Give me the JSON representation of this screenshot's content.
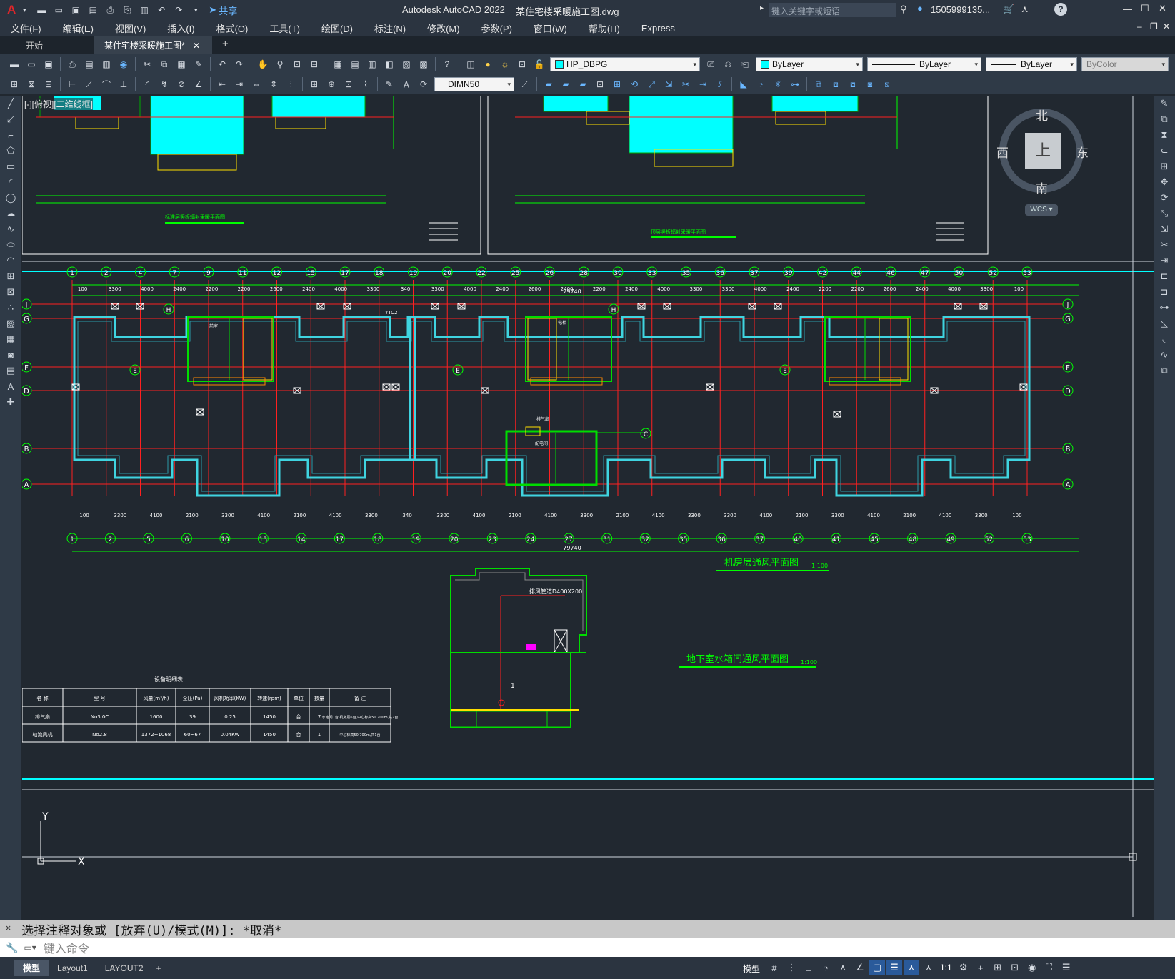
{
  "titlebar": {
    "app_title": "Autodesk AutoCAD 2022",
    "file_title": "某住宅楼采暖施工图.dwg",
    "share_label": "共享",
    "search_placeholder": "键入关键字或短语",
    "user_name": "1505999135..."
  },
  "menu": [
    "文件(F)",
    "编辑(E)",
    "视图(V)",
    "插入(I)",
    "格式(O)",
    "工具(T)",
    "绘图(D)",
    "标注(N)",
    "修改(M)",
    "参数(P)",
    "窗口(W)",
    "帮助(H)",
    "Express"
  ],
  "tabs": {
    "start": "开始",
    "doc": "某住宅楼采暖施工图*"
  },
  "toolbar": {
    "layer_name": "HP_DBPG",
    "color": "ByLayer",
    "linetype": "ByLayer",
    "lineweight": "ByLayer",
    "plotstyle": "ByColor",
    "dimstyle": "DIMN50"
  },
  "viewport": {
    "label": "[-][俯视][二维线框]"
  },
  "viewcube": {
    "north": "北",
    "south": "南",
    "east": "东",
    "west": "西",
    "top": "上",
    "wcs": "WCS"
  },
  "drawing": {
    "cols_top": [
      "1",
      "2",
      "4",
      "7",
      "9",
      "11",
      "12",
      "15",
      "17",
      "18",
      "19",
      "20",
      "22",
      "25",
      "26",
      "28",
      "30",
      "33",
      "35",
      "36",
      "37",
      "39",
      "42",
      "44",
      "46",
      "47",
      "50",
      "52",
      "53"
    ],
    "cols_bottom": [
      "1",
      "2",
      "5",
      "6",
      "10",
      "13",
      "14",
      "17",
      "18",
      "19",
      "20",
      "23",
      "24",
      "27",
      "31",
      "32",
      "35",
      "36",
      "37",
      "40",
      "41",
      "45",
      "48",
      "49",
      "52",
      "53"
    ],
    "rows": [
      "J",
      "G",
      "F",
      "D",
      "B",
      "A"
    ],
    "dims_top": [
      "100",
      "3300",
      "4000",
      "2400",
      "2200",
      "2200",
      "2600",
      "2400",
      "4000",
      "3300",
      "340",
      "3300",
      "4000",
      "2400",
      "2600",
      "2400",
      "2200",
      "2400",
      "4000",
      "3300",
      "3300",
      "4000",
      "2400",
      "2200",
      "2200",
      "2600",
      "2400",
      "4000",
      "3300",
      "100"
    ],
    "dims_bottom": [
      "100",
      "3300",
      "4100",
      "2100",
      "3300",
      "4100",
      "2100",
      "4100",
      "3300",
      "340",
      "3300",
      "4100",
      "2100",
      "4100",
      "3300",
      "2100",
      "4100",
      "3300",
      "3300",
      "4100",
      "2100",
      "3300",
      "4100",
      "2100",
      "4100",
      "3300",
      "100"
    ],
    "total": "79740",
    "ytc": "YTC2",
    "title_main": "机房层通风平面图",
    "scale_main": "1:100",
    "title_basement": "地下室水箱间通风平面图",
    "scale_basement": "1:100",
    "duct_label": "排风管道D400X200",
    "mini_title1": "标准层竖板辐射采暖平面图",
    "mini_title2": "顶层竖板辐射采暖平面图",
    "room_labels": [
      "前室",
      "电梯",
      "排气扇",
      "配电间"
    ],
    "tag_E": "E",
    "tag_H": "H",
    "tag_C": "C",
    "tag_2": "2",
    "tag_1": "1"
  },
  "table": {
    "title": "设备明细表",
    "headers": [
      "名 称",
      "型 号",
      "风量(m³/h)",
      "全压(Pa)",
      "风机功率(KW)",
      "转速(rpm)",
      "单位",
      "数量",
      "备 注"
    ],
    "rows": [
      [
        "排气扇",
        "No3.0C",
        "1600",
        "39",
        "0.25",
        "1450",
        "台",
        "7",
        "水箱间1台,机房层6台,中心标高50.700m,共7台"
      ],
      [
        "轴流风机",
        "No2.8",
        "1372~1068",
        "60~67",
        "0.04KW",
        "1450",
        "台",
        "1",
        "中心标高50.700m,共1台"
      ]
    ]
  },
  "command": {
    "history": "选择注释对象或 [放弃(U)/模式(M)]: *取消*",
    "placeholder": "键入命令"
  },
  "status": {
    "tabs": [
      "模型",
      "Layout1",
      "LAYOUT2"
    ],
    "model": "模型",
    "scale": "1:1"
  },
  "colors": {
    "cyan": "#00ffff",
    "green": "#00dd00",
    "red": "#ff2020",
    "yellow": "#ffe000",
    "bg": "#212830"
  }
}
